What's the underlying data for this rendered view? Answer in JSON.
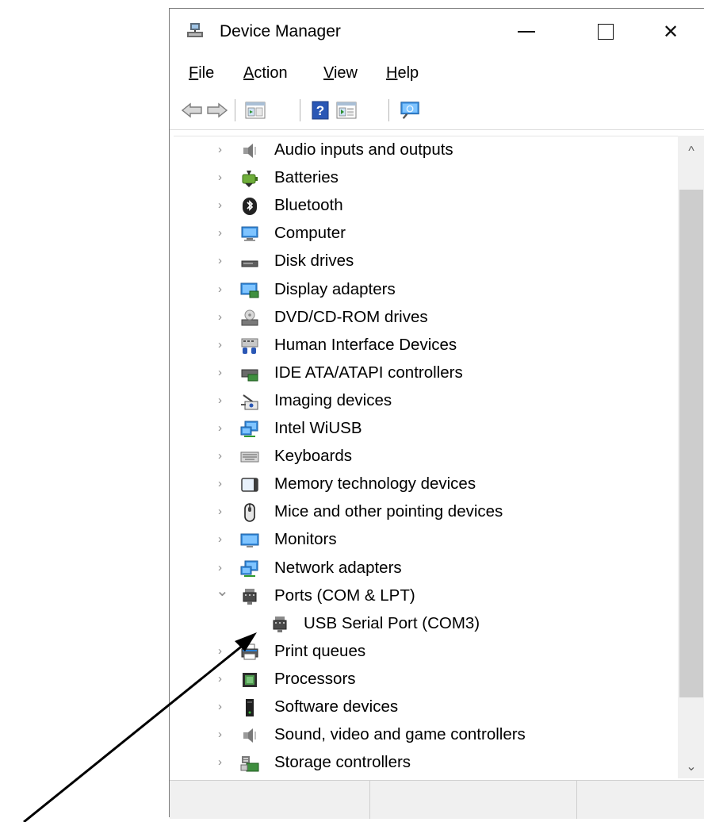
{
  "window": {
    "title": "Device Manager",
    "minimize_glyph": "—",
    "close_glyph": "✕"
  },
  "menu": {
    "file": {
      "accel": "F",
      "rest": "ile"
    },
    "action": {
      "accel": "A",
      "rest": "ction"
    },
    "view": {
      "accel": "V",
      "rest": "iew"
    },
    "help": {
      "accel": "H",
      "rest": "elp"
    }
  },
  "toolbar": {
    "icons": [
      "back-arrow-icon",
      "forward-arrow-icon",
      "properties-icon",
      "help-icon",
      "view-icon",
      "scan-hardware-icon"
    ]
  },
  "tree": {
    "expanded_glyph": "⌄",
    "collapsed_glyph": "›",
    "items": [
      {
        "label": "Audio inputs and outputs",
        "icon": "speaker-icon"
      },
      {
        "label": "Batteries",
        "icon": "battery-icon"
      },
      {
        "label": "Bluetooth",
        "icon": "bluetooth-icon"
      },
      {
        "label": "Computer",
        "icon": "computer-icon"
      },
      {
        "label": "Disk drives",
        "icon": "disk-drive-icon"
      },
      {
        "label": "Display adapters",
        "icon": "display-adapter-icon"
      },
      {
        "label": "DVD/CD-ROM drives",
        "icon": "dvd-drive-icon"
      },
      {
        "label": "Human Interface Devices",
        "icon": "hid-icon"
      },
      {
        "label": "IDE ATA/ATAPI controllers",
        "icon": "ide-controller-icon"
      },
      {
        "label": "Imaging devices",
        "icon": "imaging-device-icon"
      },
      {
        "label": "Intel WiUSB",
        "icon": "network-icon"
      },
      {
        "label": "Keyboards",
        "icon": "keyboard-icon"
      },
      {
        "label": "Memory technology devices",
        "icon": "memory-device-icon"
      },
      {
        "label": "Mice and other pointing devices",
        "icon": "mouse-icon"
      },
      {
        "label": "Monitors",
        "icon": "monitor-icon"
      },
      {
        "label": "Network adapters",
        "icon": "network-adapter-icon"
      },
      {
        "label": "Ports (COM & LPT)",
        "icon": "port-icon",
        "expanded": true
      },
      {
        "label": "USB Serial Port (COM3)",
        "icon": "port-icon",
        "child": true
      },
      {
        "label": "Print queues",
        "icon": "printer-icon"
      },
      {
        "label": "Processors",
        "icon": "processor-icon"
      },
      {
        "label": "Software devices",
        "icon": "software-device-icon"
      },
      {
        "label": "Sound, video and game controllers",
        "icon": "speaker-icon"
      },
      {
        "label": "Storage controllers",
        "icon": "storage-controller-icon"
      }
    ]
  },
  "scrollbar": {
    "up_glyph": "^",
    "down_glyph": "⌄"
  },
  "annotation": {
    "arrow_color": "#000000"
  },
  "colors": {
    "accent_blue": "#2b7cd3",
    "selection": "#cce8ff"
  }
}
